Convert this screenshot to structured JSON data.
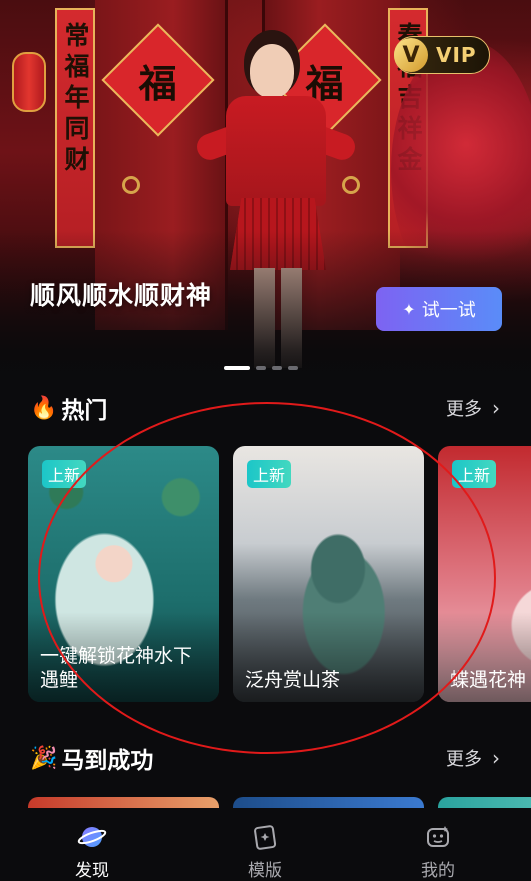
{
  "hero": {
    "couplet_left": "常福年同财",
    "couplet_right": "春福吉祥金",
    "fu_char": "福",
    "vip_icon": "V",
    "vip_label": "VIP",
    "title": "顺风顺水顺财神",
    "try_icon": "sparkle-icon",
    "try_label": "试一试",
    "carousel": {
      "count": 4,
      "active": 0
    }
  },
  "hot": {
    "emoji": "🔥",
    "title": "热门",
    "more_label": "更多",
    "cards": [
      {
        "tag": "上新",
        "label": "一键解锁花神水下遇鲤"
      },
      {
        "tag": "上新",
        "label": "泛舟赏山茶"
      },
      {
        "tag": "上新",
        "label": "蝶遇花神"
      }
    ]
  },
  "section2": {
    "emoji": "🎉",
    "title": "马到成功",
    "more_label": "更多"
  },
  "tabbar": {
    "items": [
      {
        "icon": "planet-icon",
        "label": "发现",
        "active": true
      },
      {
        "icon": "template-icon",
        "label": "模版",
        "active": false
      },
      {
        "icon": "robot-face-icon",
        "label": "我的",
        "active": false
      }
    ]
  },
  "colors": {
    "background": "#0b0b0d",
    "accent_gradient": [
      "#7d63f2",
      "#5a8cf8"
    ],
    "tag_gradient": [
      "#1cc6c8",
      "#43d8c0"
    ],
    "vip_gold": "#f4cf74",
    "annotation": "#e11a1a"
  }
}
